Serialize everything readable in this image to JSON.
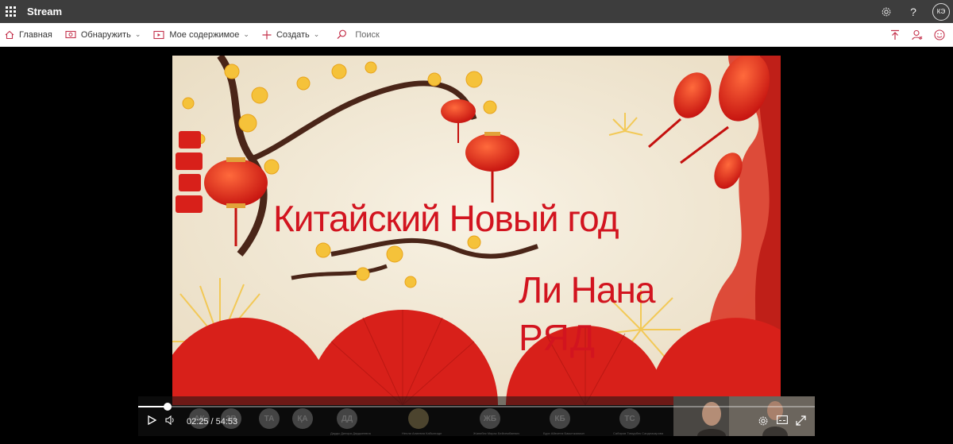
{
  "suitebar": {
    "app_name": "Stream",
    "avatar_initials": "КЭ",
    "icons": [
      "waffle-icon",
      "gear-icon",
      "help-icon"
    ]
  },
  "nav": {
    "home": "Главная",
    "discover": "Обнаружить",
    "my_content": "Мое содержимое",
    "create": "Создать",
    "search": "Поиск",
    "right_icons": [
      "upload-icon",
      "profile-icon",
      "feedback-icon"
    ]
  },
  "video": {
    "title_line1": "Китайский Новый год",
    "title_line2": "Ли Нана",
    "title_line3": "РЯД"
  },
  "player": {
    "current_time": "02:25",
    "separator": "/",
    "duration": "54:53",
    "progress_fraction": 0.044,
    "participants": [
      {
        "initials": "АК"
      },
      {
        "initials": "ЗВ"
      },
      {
        "initials": "ТА"
      },
      {
        "initials": "ҚА"
      },
      {
        "initials": "ДД",
        "name": "Дауды Диляра Дауджеевна"
      },
      {
        "initials": "",
        "name": "Нелли Алиевна Кабылгаде"
      },
      {
        "initials": "ЖБ",
        "name": "Жанибек Мирас Бейсембаевич"
      },
      {
        "initials": "КБ",
        "name": "Бурх Айекетм Бакытжанкын"
      },
      {
        "initials": "ТС",
        "name": "Сабиров Тимурбек Саидназарова"
      }
    ]
  },
  "colors": {
    "suitebar_bg": "#3d3d3d",
    "accent": "#c4314b",
    "title_red": "#d2141f"
  }
}
